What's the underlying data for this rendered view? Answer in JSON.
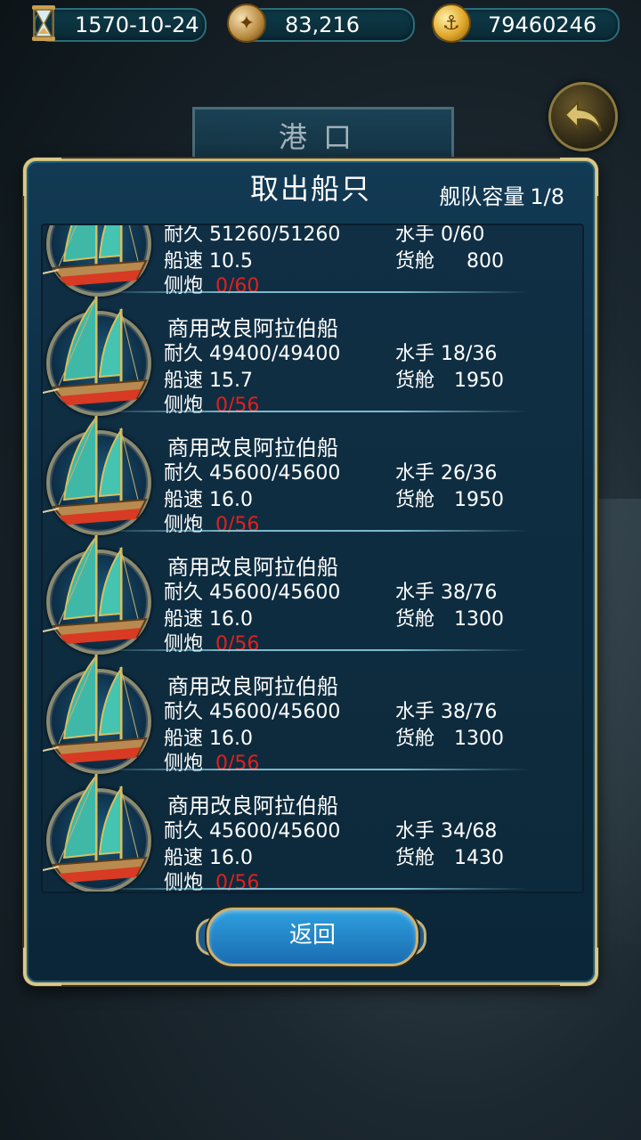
{
  "status": {
    "date": "1570-10-24",
    "money": "83,216",
    "gold": "79460246"
  },
  "background": {
    "header_tab": "港口"
  },
  "dialog": {
    "title": "取出船只",
    "capacity_label": "舰队容量",
    "capacity_value": "1/8",
    "return_label": "返回",
    "labels": {
      "durability": "耐久",
      "speed": "船速",
      "cannon": "侧炮",
      "crew": "水手",
      "cargo": "货舱"
    },
    "ships": [
      {
        "name": "",
        "durability": "51260/51260",
        "speed": "10.5",
        "cannon": "0/60",
        "crew": "0/60",
        "cargo": "800"
      },
      {
        "name": "商用改良阿拉伯船",
        "durability": "49400/49400",
        "speed": "15.7",
        "cannon": "0/56",
        "crew": "18/36",
        "cargo": "1950"
      },
      {
        "name": "商用改良阿拉伯船",
        "durability": "45600/45600",
        "speed": "16.0",
        "cannon": "0/56",
        "crew": "26/36",
        "cargo": "1950"
      },
      {
        "name": "商用改良阿拉伯船",
        "durability": "45600/45600",
        "speed": "16.0",
        "cannon": "0/56",
        "crew": "38/76",
        "cargo": "1300"
      },
      {
        "name": "商用改良阿拉伯船",
        "durability": "45600/45600",
        "speed": "16.0",
        "cannon": "0/56",
        "crew": "38/76",
        "cargo": "1300"
      },
      {
        "name": "商用改良阿拉伯船",
        "durability": "45600/45600",
        "speed": "16.0",
        "cannon": "0/56",
        "crew": "34/68",
        "cargo": "1430"
      }
    ]
  }
}
